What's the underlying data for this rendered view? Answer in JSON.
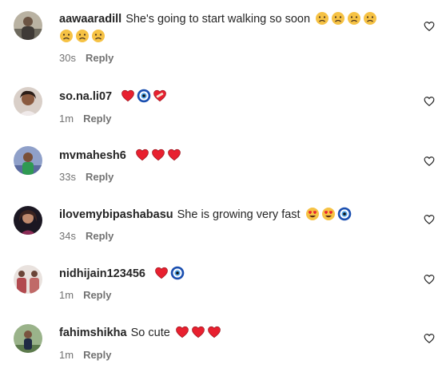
{
  "reply_label": "Reply",
  "colors": {
    "text": "#262626",
    "muted": "#737373",
    "heart": "#e8202f",
    "evil_eye": "#1a4fb0",
    "sad_face": "#f6c244"
  },
  "comments": [
    {
      "username": "aawaaradill",
      "text": "She's going to start walking so soon",
      "emojis": [
        "sad-face",
        "sad-face",
        "sad-face",
        "sad-face",
        "sad-face",
        "sad-face",
        "sad-face"
      ],
      "time": "30s"
    },
    {
      "username": "so.na.li07",
      "text": "",
      "emojis": [
        "red-heart",
        "evil-eye",
        "mending-heart"
      ],
      "time": "1m"
    },
    {
      "username": "mvmahesh6",
      "text": "",
      "emojis": [
        "red-heart",
        "red-heart",
        "red-heart"
      ],
      "time": "33s"
    },
    {
      "username": "ilovemybipashabasu",
      "text": "She is growing very fast",
      "emojis": [
        "heart-eyes-face",
        "heart-eyes-face",
        "evil-eye"
      ],
      "time": "34s"
    },
    {
      "username": "nidhijain123456",
      "text": "",
      "emojis": [
        "red-heart",
        "evil-eye"
      ],
      "time": "1m"
    },
    {
      "username": "fahimshikha",
      "text": "So cute",
      "emojis": [
        "red-heart",
        "red-heart",
        "red-heart"
      ],
      "time": "1m"
    }
  ]
}
